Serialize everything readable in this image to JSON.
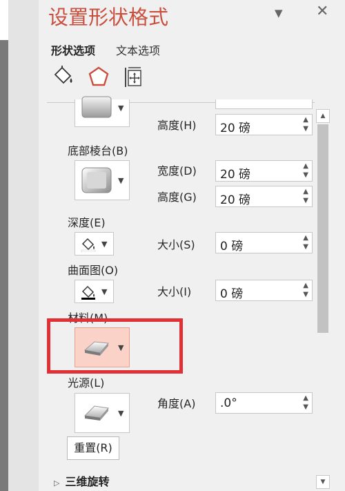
{
  "panel": {
    "title": "设置形状格式",
    "pin_icon": "chevron-down-icon",
    "close_icon": "close-icon",
    "close_label": "✕",
    "pin_label": "▼"
  },
  "tabs": [
    {
      "label": "形状选项",
      "active": true
    },
    {
      "label": "文本选项",
      "active": false
    }
  ],
  "icon_tabs": [
    "fill-line-icon",
    "effects-pentagon-icon",
    "size-properties-icon"
  ],
  "accent_color": "#c9503f",
  "top_bevel": {
    "height_label": "高度(H)",
    "height_value": "20 磅"
  },
  "bottom_bevel": {
    "label": "底部棱台(B)",
    "width_label": "宽度(D)",
    "width_value": "20 磅",
    "height_label": "高度(G)",
    "height_value": "20 磅"
  },
  "depth": {
    "label": "深度(E)",
    "size_label": "大小(S)",
    "size_value": "0 磅"
  },
  "contour": {
    "label": "曲面图(O)",
    "size_label": "大小(I)",
    "size_value": "0 磅"
  },
  "material": {
    "label": "材料(M)"
  },
  "lighting": {
    "label": "光源(L)",
    "angle_label": "角度(A)",
    "angle_value": ".0°"
  },
  "reset_label": "重置(R)",
  "section_3d_rotation": "三维旋转"
}
